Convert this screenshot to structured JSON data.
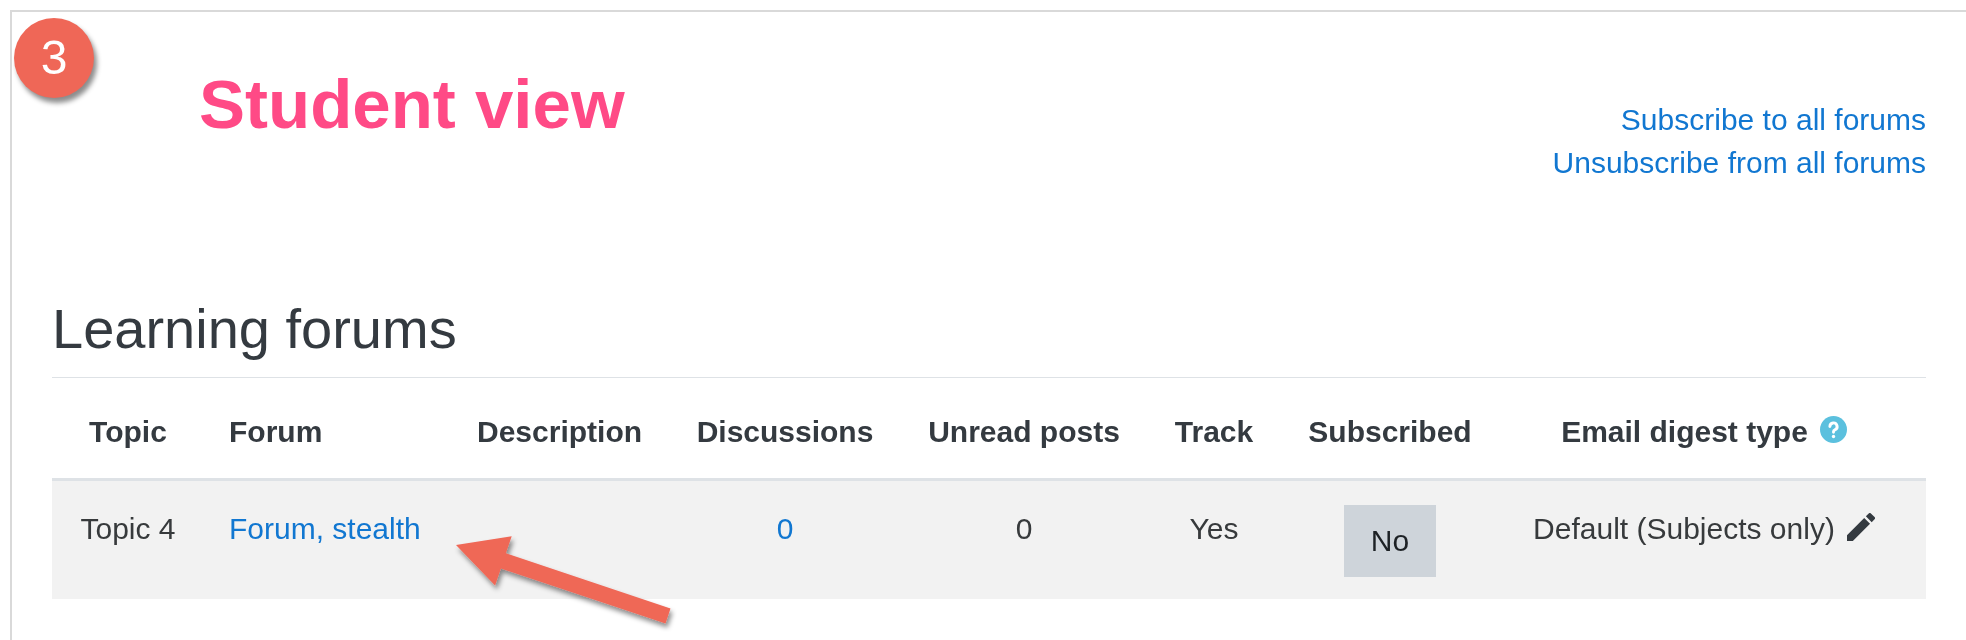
{
  "step_badge": "3",
  "caption": "Student view",
  "subscription_links": [
    "Subscribe to all forums",
    "Unsubscribe from all forums"
  ],
  "section": {
    "title": "Learning forums",
    "table": {
      "columns": [
        {
          "label": "Topic",
          "help": false
        },
        {
          "label": "Forum",
          "help": false
        },
        {
          "label": "Description",
          "help": false
        },
        {
          "label": "Discussions",
          "help": false
        },
        {
          "label": "Unread posts",
          "help": false
        },
        {
          "label": "Track",
          "help": false
        },
        {
          "label": "Subscribed",
          "help": false
        },
        {
          "label": "Email digest type",
          "help": true
        }
      ],
      "rows": [
        {
          "topic": "Topic 4",
          "forum": "Forum, stealth",
          "discussions": "0",
          "unread_posts": "0",
          "track": "Yes",
          "subscribed": "No",
          "email_digest_type": "Default (Subjects only)"
        }
      ]
    }
  }
}
